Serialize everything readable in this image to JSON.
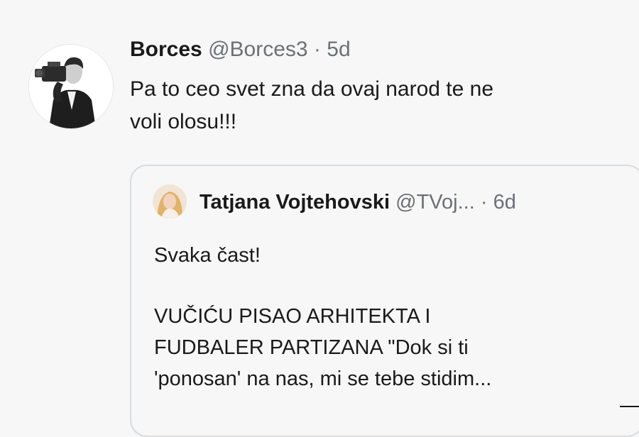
{
  "tweet": {
    "author_name": "Borces",
    "handle": "@Borces3",
    "separator": "·",
    "time": "5d",
    "text_lines": [
      "Pa to ceo svet zna da ovaj narod te ne",
      "voli olosu!!!"
    ]
  },
  "quoted_tweet": {
    "author_name": "Tatjana Vojtehovski",
    "handle": "@TVoj...",
    "separator": "·",
    "time": "6d",
    "greeting": "Svaka čast!",
    "body_lines": [
      "VUČIĆU PISAO ARHITEKTA I",
      "FUDBALER PARTIZANA \"Dok si ti",
      "'ponosan' na nas, mi se tebe stidim..."
    ]
  },
  "icons": {
    "avatar": "man-with-camera-avatar",
    "quoted_avatar": "woman-portrait-avatar"
  },
  "colors": {
    "background": "#f7f7f7",
    "text": "#1a1a1a",
    "secondary_text": "#6b7177",
    "border": "#d8dce0"
  }
}
